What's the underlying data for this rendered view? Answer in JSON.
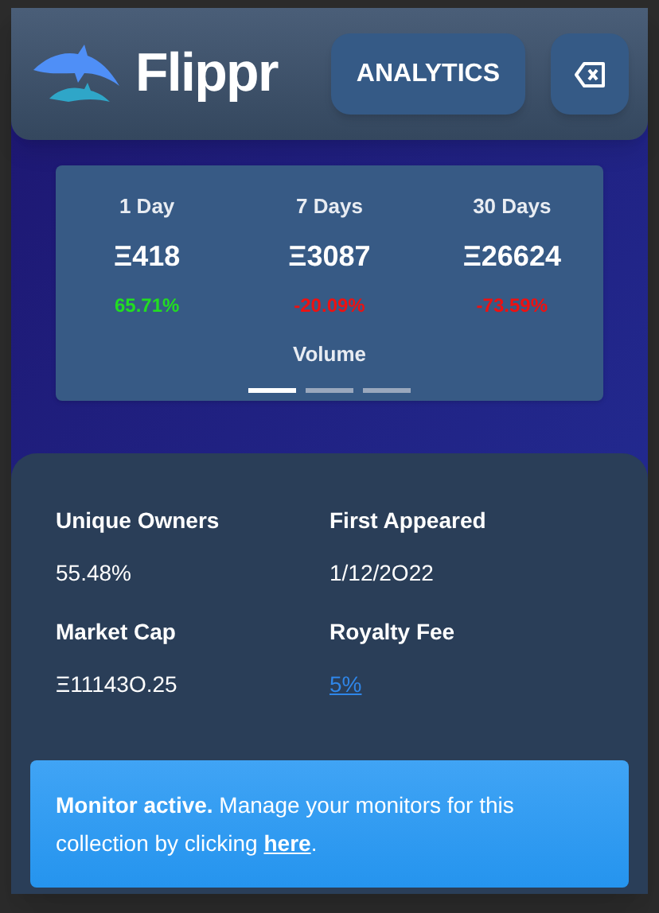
{
  "header": {
    "logo_text": "Flippr",
    "analytics_button": "ANALYTICS"
  },
  "volume_card": {
    "periods": [
      {
        "label": "1 Day",
        "value": "Ξ418",
        "change": "65.71%",
        "color": "#22dd22"
      },
      {
        "label": "7 Days",
        "value": "Ξ3087",
        "change": "-20.09%",
        "color": "#ee1111"
      },
      {
        "label": "30 Days",
        "value": "Ξ26624",
        "change": "-73.59%",
        "color": "#ee1111"
      }
    ],
    "caption": "Volume",
    "pages": [
      {
        "selected": true
      },
      {
        "selected": false
      },
      {
        "selected": false
      }
    ]
  },
  "stats": [
    {
      "label": "Unique Owners",
      "value": "55.48%",
      "kind": "text"
    },
    {
      "label": "First Appeared",
      "value": "1/12/2O22",
      "kind": "text"
    },
    {
      "label": "Market Cap",
      "value": "Ξ11143O.25",
      "kind": "text"
    },
    {
      "label": "Royalty Fee",
      "value": "5%",
      "kind": "link"
    }
  ],
  "notice": {
    "text": "**Monitor active.** Manage your monitors for this collection by clicking",
    "link": "here",
    "end": "."
  }
}
